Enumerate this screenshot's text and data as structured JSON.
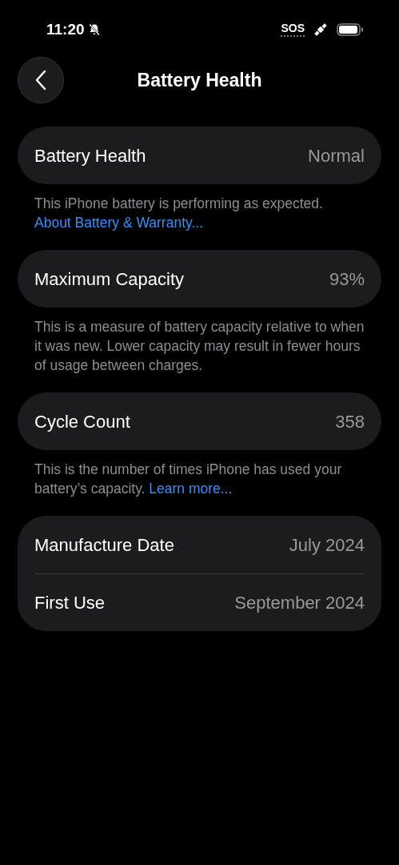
{
  "status_bar": {
    "time": "11:20",
    "carrier": "SOS"
  },
  "nav": {
    "title": "Battery Health"
  },
  "sections": [
    {
      "rows": [
        {
          "label": "Battery Health",
          "value": "Normal"
        }
      ],
      "footer": {
        "text": "This iPhone battery is performing as expected. ",
        "link": "About Battery & Warranty..."
      }
    },
    {
      "rows": [
        {
          "label": "Maximum Capacity",
          "value": "93%"
        }
      ],
      "footer": {
        "text": "This is a measure of battery capacity relative to when it was new. Lower capacity may result in fewer hours of usage between charges."
      }
    },
    {
      "rows": [
        {
          "label": "Cycle Count",
          "value": "358"
        }
      ],
      "footer": {
        "text": "This is the number of times iPhone has used your battery’s capacity. ",
        "link": "Learn more..."
      }
    },
    {
      "rows": [
        {
          "label": "Manufacture Date",
          "value": "July 2024"
        },
        {
          "label": "First Use",
          "value": "September 2024"
        }
      ]
    }
  ]
}
